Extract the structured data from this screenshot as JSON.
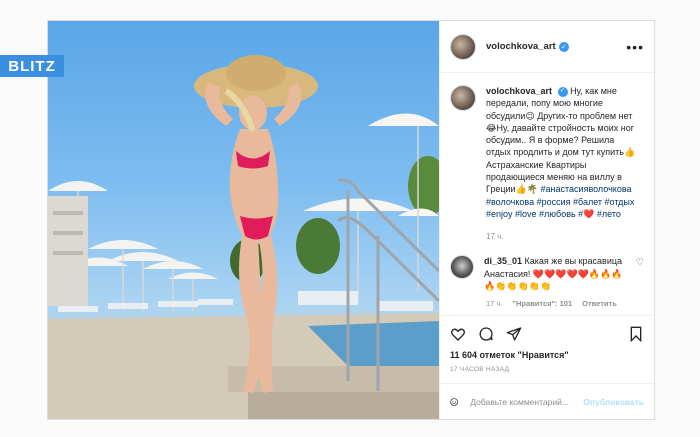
{
  "badge": {
    "label": "BLITZ"
  },
  "post": {
    "author": "volochkova_art",
    "caption": {
      "author": "volochkova_art",
      "text": "Ну, как мне передали, попу мою многие обсудили😉 Других-то проблем нет😂Ну, давайте стройность моих ног обсудим.. Я в форме? Решила отдых продлить и дом тут купить👍 Астраханские Квартиры продающиеся меняю на виллу в Греции👍🌴",
      "hashtags": "#анастасияволочкова #волочкова #россия #балет #отдых #enjoy #love #любовь #❤️ #лето",
      "time": "17 ч."
    },
    "reply": {
      "author": "di_35_01",
      "text": "Какая же вы красавица Анастасия! ❤️❤️❤️❤️❤️🔥🔥🔥🔥👏👏👏👏👏",
      "time": "17 ч.",
      "likes": "\"Нравится\": 101",
      "reply_label": "Ответить"
    },
    "likes": "11 604 отметок \"Нравится\"",
    "time_ago": "17 ЧАСОВ НАЗАД",
    "comment_placeholder": "Добавьте комментарий...",
    "publish_label": "Опубликовать"
  },
  "icons": {
    "more": "more-icon",
    "heart": "heart-icon",
    "comment": "comment-icon",
    "share": "share-icon",
    "bookmark": "bookmark-icon",
    "smile": "emoji-icon"
  },
  "colors": {
    "badge": "#3b8fe0",
    "verified": "#3897f0",
    "hashtag": "#00376b",
    "publish_disabled": "#b2dffc"
  }
}
